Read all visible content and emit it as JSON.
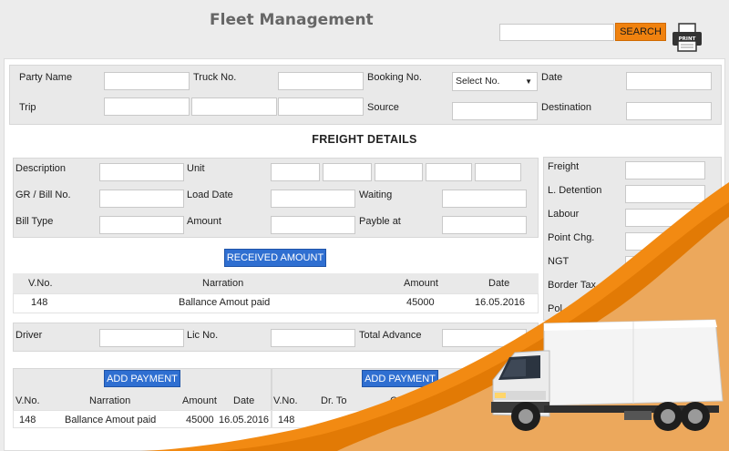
{
  "header": {
    "title": "Fleet Management",
    "search_placeholder": "",
    "search_button": "SEARCH",
    "print_label": "PRINT"
  },
  "booking": {
    "party_name": "Party Name",
    "truck_no": "Truck No.",
    "booking_no": "Booking No.",
    "booking_select": "Select No.",
    "date": "Date",
    "trip": "Trip",
    "source": "Source",
    "destination": "Destination"
  },
  "freight": {
    "section_title": "FREIGHT DETAILS",
    "description": "Description",
    "unit": "Unit",
    "gr_bill_no": "GR / Bill No.",
    "load_date": "Load Date",
    "waiting": "Waiting",
    "bill_type": "Bill Type",
    "amount": "Amount",
    "payble_at": "Payble at"
  },
  "charges": {
    "items": [
      "Freight",
      "L. Detention",
      "Labour",
      "Point Chg.",
      "NGT",
      "Border Tax",
      "Pol. Challan"
    ]
  },
  "received": {
    "button": "RECEIVED AMOUNT",
    "columns": [
      "V.No.",
      "Narration",
      "Amount",
      "Date"
    ],
    "rows": [
      {
        "vno": "148",
        "narration": "Ballance Amout paid",
        "amount": "45000",
        "date": "16.05.2016"
      }
    ]
  },
  "driver": {
    "driver": "Driver",
    "lic_no": "Lic No.",
    "total_advance": "Total Advance"
  },
  "payment_left": {
    "button": "ADD PAYMENT",
    "columns": [
      "V.No.",
      "Narration",
      "Amount",
      "Date"
    ],
    "rows": [
      {
        "vno": "148",
        "narration": "Ballance Amout paid",
        "amount": "45000",
        "date": "16.05.2016"
      }
    ]
  },
  "payment_right": {
    "button": "ADD PAYMENT",
    "columns": [
      "V.No.",
      "Dr. To",
      "Cr. T"
    ],
    "rows": [
      {
        "vno": "148"
      }
    ]
  },
  "colors": {
    "accent": "#f0820f",
    "button_blue": "#2f6fd1",
    "panel_grey": "#e9e9e9"
  }
}
